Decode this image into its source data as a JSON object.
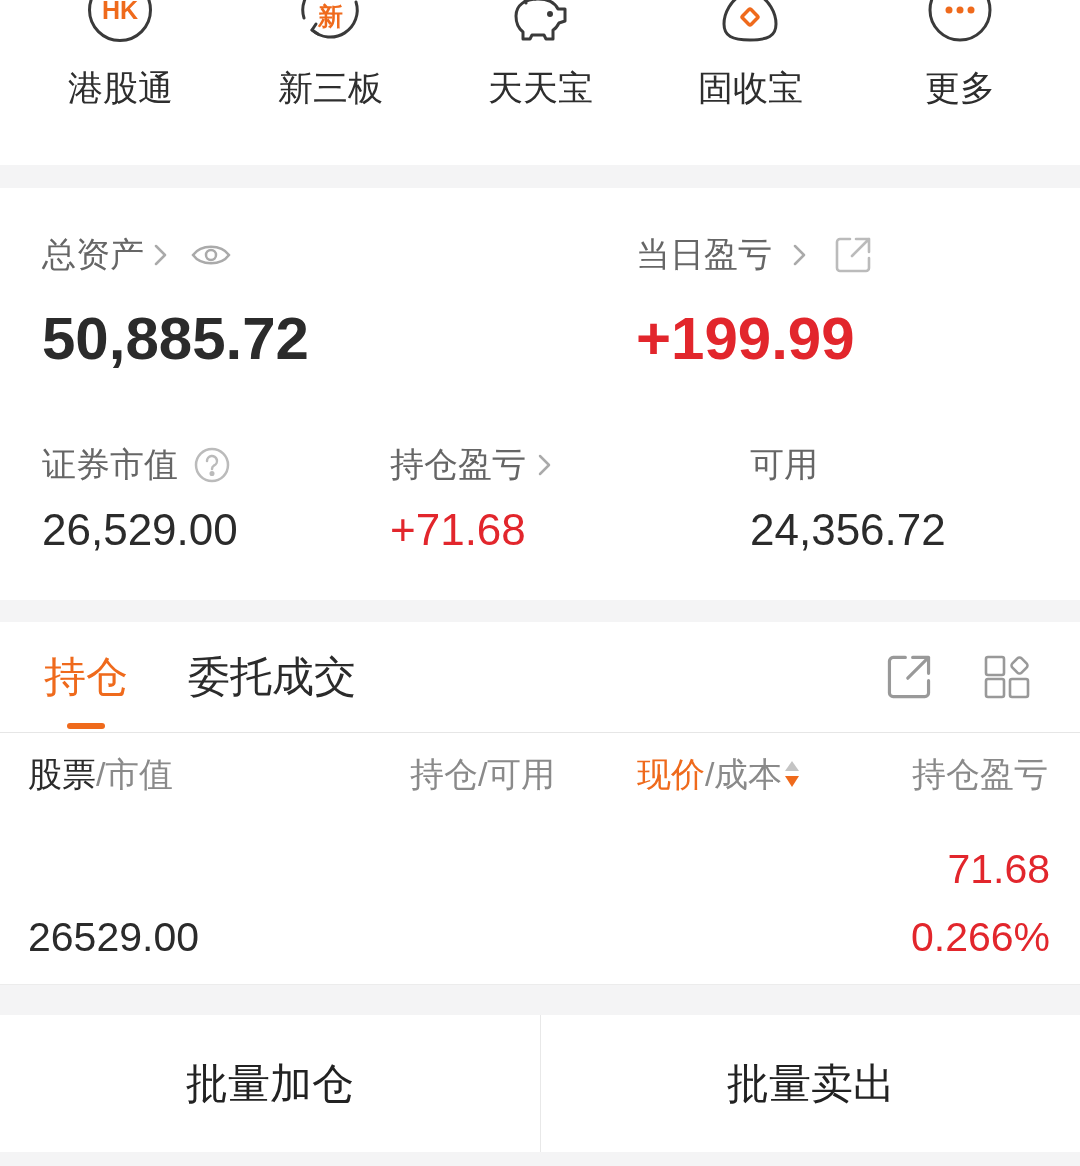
{
  "shortcuts": [
    {
      "kind": "hk",
      "label": "港股通",
      "badge": "HK"
    },
    {
      "kind": "cycle",
      "label": "新三板",
      "badge": "新"
    },
    {
      "kind": "piggy",
      "label": "天天宝"
    },
    {
      "kind": "pouch",
      "label": "固收宝"
    },
    {
      "kind": "more",
      "label": "更多"
    }
  ],
  "assets": {
    "total": {
      "label": "总资产",
      "value": "50,885.72"
    },
    "daily_pnl": {
      "label": "当日盈亏",
      "value": "+199.99",
      "gain": true
    },
    "stats": [
      {
        "kind": "help",
        "label": "证券市值",
        "value": "26,529.00"
      },
      {
        "kind": "link",
        "label": "持仓盈亏",
        "value": "+71.68",
        "gain": true
      },
      {
        "kind": "plain",
        "label": "可用",
        "value": "24,356.72"
      }
    ]
  },
  "tabs": [
    {
      "label": "持仓",
      "selected": true
    },
    {
      "label": "委托成交",
      "selected": false
    }
  ],
  "table": {
    "columns": [
      {
        "kind": "name",
        "label": "股票",
        "sublabel": "/市值",
        "selected": false
      },
      {
        "kind": "plain",
        "label": "持仓/可用",
        "selected": false
      },
      {
        "kind": "sortable",
        "label": "现价",
        "sublabel": "/成本",
        "selected": true,
        "descending": true
      },
      {
        "kind": "plain",
        "label": "持仓盈亏",
        "selected": false
      }
    ],
    "rows": [
      {
        "market_value": "26529.00",
        "pnl": "71.68",
        "pnl_ratio": "0.266%",
        "gain": true
      }
    ]
  },
  "actions": [
    {
      "label": "批量加仓"
    },
    {
      "label": "批量卖出"
    }
  ]
}
